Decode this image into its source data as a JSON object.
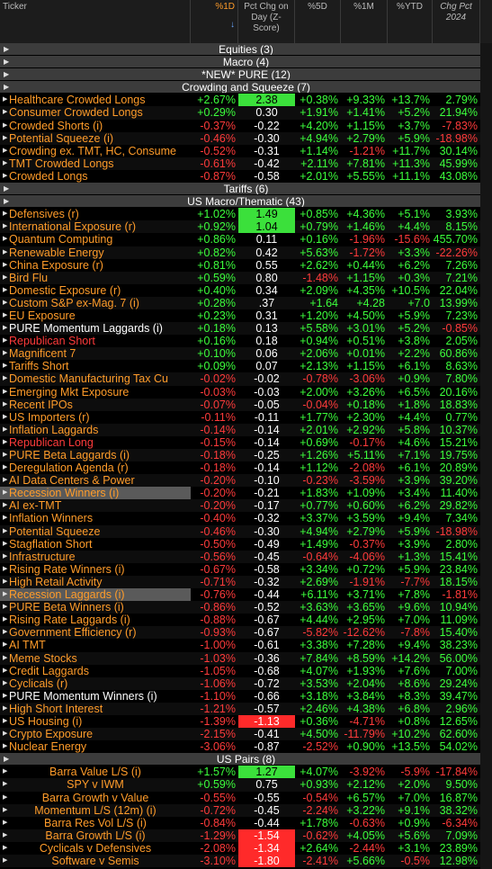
{
  "header": {
    "ticker": "Ticker",
    "pct1d": "%1D",
    "sort_arrow": "↓",
    "zscore": "Pct Chg on Day (Z-Score)",
    "pct5d": "%5D",
    "pct1m": "%1M",
    "pctytd": "%YTD",
    "chg2024": "Chg Pct 2024"
  },
  "colors": {
    "orange": "#ff9c2a",
    "green": "#3cff3c",
    "red": "#ff3b3b",
    "group_bg": "#3c3c3c"
  },
  "rows": [
    {
      "g": "Equities (3)"
    },
    {
      "g": "Macro (4)"
    },
    {
      "g": "*NEW* PURE (12)"
    },
    {
      "g": "Crowding and Squeeze (7)"
    },
    {
      "n": "Healthcare Crowded Longs",
      "d": "+2.67%",
      "z": "2.38",
      "zb": "g",
      "f": "+0.38%",
      "m": "+9.33%",
      "y": "+13.7%",
      "c": "2.79%"
    },
    {
      "n": "Consumer Crowded Longs",
      "d": "+0.29%",
      "z": "0.30",
      "f": "+1.91%",
      "m": "+1.41%",
      "y": "+5.2%",
      "c": "21.94%"
    },
    {
      "n": "Crowded Shorts (i)",
      "d": "-0.37%",
      "z": "-0.22",
      "f": "+4.20%",
      "m": "+1.15%",
      "y": "+3.7%",
      "c": "-7.83%"
    },
    {
      "n": "Potential Squeeze (i)",
      "d": "-0.46%",
      "z": "-0.30",
      "f": "+4.94%",
      "m": "+2.79%",
      "y": "+5.9%",
      "c": "-18.98%"
    },
    {
      "n": "Crowding ex. TMT, HC, Consume",
      "d": "-0.52%",
      "z": "-0.31",
      "f": "+1.14%",
      "m": "-1.21%",
      "y": "+11.7%",
      "c": "30.14%"
    },
    {
      "n": "TMT Crowded Longs",
      "d": "-0.61%",
      "z": "-0.42",
      "f": "+2.11%",
      "m": "+7.81%",
      "y": "+11.3%",
      "c": "45.99%"
    },
    {
      "n": "Crowded Longs",
      "d": "-0.87%",
      "z": "-0.58",
      "f": "+2.01%",
      "m": "+5.55%",
      "y": "+11.1%",
      "c": "43.08%"
    },
    {
      "g": "Tariffs (6)"
    },
    {
      "g": "US Macro/Thematic (43)"
    },
    {
      "n": "Defensives (r)",
      "d": "+1.02%",
      "z": "1.49",
      "zb": "g",
      "f": "+0.85%",
      "m": "+4.36%",
      "y": "+5.1%",
      "c": "3.93%"
    },
    {
      "n": "International Exposure (r)",
      "d": "+0.92%",
      "z": "1.04",
      "zb": "g",
      "f": "+0.79%",
      "m": "+1.46%",
      "y": "+4.4%",
      "c": "8.15%"
    },
    {
      "n": "Quantum Computing",
      "d": "+0.86%",
      "z": "0.11",
      "f": "+0.16%",
      "m": "-1.96%",
      "y": "-15.6%",
      "c": "455.70%"
    },
    {
      "n": "Renewable Energy",
      "d": "+0.82%",
      "z": "0.42",
      "f": "+5.63%",
      "m": "-1.72%",
      "y": "+3.3%",
      "c": "-22.26%"
    },
    {
      "n": "China Exposure (r)",
      "d": "+0.81%",
      "z": "0.55",
      "f": "+2.62%",
      "m": "+0.44%",
      "y": "+6.2%",
      "c": "7.26%"
    },
    {
      "n": "Bird Flu",
      "d": "+0.59%",
      "z": "0.80",
      "f": "-1.48%",
      "m": "+1.15%",
      "y": "+0.3%",
      "c": "7.21%"
    },
    {
      "n": "Domestic Exposure (r)",
      "d": "+0.40%",
      "z": "0.34",
      "f": "+2.09%",
      "m": "+4.35%",
      "y": "+10.5%",
      "c": "22.04%"
    },
    {
      "n": "Custom S&P ex-Mag. 7 (i)",
      "d": "+0.28%",
      "z": ".37",
      "f": "+1.64",
      "m": "+4.28",
      "y": "+7.0",
      "c": "13.99%"
    },
    {
      "n": "EU Exposure",
      "d": "+0.23%",
      "z": "0.31",
      "f": "+1.20%",
      "m": "+4.50%",
      "y": "+5.9%",
      "c": "7.23%"
    },
    {
      "n": "PURE Momentum Laggards (i)",
      "nc": "white",
      "d": "+0.18%",
      "z": "0.13",
      "f": "+5.58%",
      "m": "+3.01%",
      "y": "+5.2%",
      "c": "-0.85%"
    },
    {
      "n": "Republican Short",
      "nc": "red",
      "d": "+0.16%",
      "z": "0.18",
      "f": "+0.94%",
      "m": "+0.51%",
      "y": "+3.8%",
      "c": "2.05%"
    },
    {
      "n": "Magnificent 7",
      "d": "+0.10%",
      "z": "0.06",
      "f": "+2.06%",
      "m": "+0.01%",
      "y": "+2.2%",
      "c": "60.86%"
    },
    {
      "n": "Tariffs Short",
      "d": "+0.09%",
      "z": "0.07",
      "f": "+2.13%",
      "m": "+1.15%",
      "y": "+6.1%",
      "c": "8.63%"
    },
    {
      "n": "Domestic Manufacturing Tax Cu",
      "d": "-0.02%",
      "z": "-0.02",
      "f": "-0.78%",
      "m": "-3.06%",
      "y": "+0.9%",
      "c": "7.80%"
    },
    {
      "n": "Emerging Mkt Exposure",
      "d": "-0.03%",
      "z": "-0.03",
      "f": "+2.00%",
      "m": "+3.26%",
      "y": "+6.5%",
      "c": "20.16%"
    },
    {
      "n": "Recent IPOs",
      "d": "-0.07%",
      "z": "-0.05",
      "f": "-0.04%",
      "m": "+0.18%",
      "y": "+1.8%",
      "c": "18.83%"
    },
    {
      "n": "US Importers (r)",
      "d": "-0.11%",
      "z": "-0.11",
      "f": "+1.77%",
      "m": "+2.30%",
      "y": "+4.4%",
      "c": "0.77%"
    },
    {
      "n": "Inflation Laggards",
      "d": "-0.14%",
      "z": "-0.14",
      "f": "+2.01%",
      "m": "+2.92%",
      "y": "+5.8%",
      "c": "10.37%"
    },
    {
      "n": "Republican Long",
      "nc": "red",
      "d": "-0.15%",
      "z": "-0.14",
      "f": "+0.69%",
      "m": "-0.17%",
      "y": "+4.6%",
      "c": "15.21%"
    },
    {
      "n": "PURE Beta Laggards (i)",
      "d": "-0.18%",
      "z": "-0.25",
      "f": "+1.26%",
      "m": "+5.11%",
      "y": "+7.1%",
      "c": "19.75%"
    },
    {
      "n": "Deregulation Agenda (r)",
      "d": "-0.18%",
      "z": "-0.14",
      "f": "+1.12%",
      "m": "-2.08%",
      "y": "+6.1%",
      "c": "20.89%"
    },
    {
      "n": "AI Data Centers & Power",
      "d": "-0.20%",
      "z": "-0.10",
      "f": "-0.23%",
      "m": "-3.59%",
      "y": "+3.9%",
      "c": "39.20%"
    },
    {
      "n": "Recession Winners (i)",
      "hl": true,
      "d": "-0.20%",
      "z": "-0.21",
      "f": "+1.83%",
      "m": "+1.09%",
      "y": "+3.4%",
      "c": "11.40%"
    },
    {
      "n": "AI ex-TMT",
      "d": "-0.20%",
      "z": "-0.17",
      "f": "+0.77%",
      "m": "+0.60%",
      "y": "+6.2%",
      "c": "29.82%"
    },
    {
      "n": "Inflation Winners",
      "d": "-0.40%",
      "z": "-0.32",
      "f": "+3.37%",
      "m": "+3.59%",
      "y": "+9.4%",
      "c": "7.34%"
    },
    {
      "n": "Potential Squeeze",
      "d": "-0.46%",
      "z": "-0.30",
      "f": "+4.94%",
      "m": "+2.79%",
      "y": "+5.9%",
      "c": "-18.98%"
    },
    {
      "n": "Stagflation Short",
      "d": "-0.50%",
      "z": "-0.49",
      "f": "+1.49%",
      "m": "-0.37%",
      "y": "+3.9%",
      "c": "2.80%"
    },
    {
      "n": "Infrastructure",
      "d": "-0.56%",
      "z": "-0.45",
      "f": "-0.64%",
      "m": "-4.06%",
      "y": "+1.3%",
      "c": "15.41%"
    },
    {
      "n": "Rising Rate Winners (i)",
      "d": "-0.67%",
      "z": "-0.58",
      "f": "+3.34%",
      "m": "+0.72%",
      "y": "+5.9%",
      "c": "23.84%"
    },
    {
      "n": "High Retail Activity",
      "d": "-0.71%",
      "z": "-0.32",
      "f": "+2.69%",
      "m": "-1.91%",
      "y": "-7.7%",
      "c": "18.15%"
    },
    {
      "n": "Recession Laggards (i)",
      "hl": true,
      "d": "-0.76%",
      "z": "-0.44",
      "f": "+6.11%",
      "m": "+3.71%",
      "y": "+7.8%",
      "c": "-1.81%"
    },
    {
      "n": "PURE Beta Winners (i)",
      "d": "-0.86%",
      "z": "-0.52",
      "f": "+3.63%",
      "m": "+3.65%",
      "y": "+9.6%",
      "c": "10.94%"
    },
    {
      "n": "Rising Rate Laggards (i)",
      "d": "-0.88%",
      "z": "-0.67",
      "f": "+4.44%",
      "m": "+2.95%",
      "y": "+7.0%",
      "c": "11.09%"
    },
    {
      "n": "Government Efficiency (r)",
      "d": "-0.93%",
      "z": "-0.67",
      "f": "-5.82%",
      "m": "-12.62%",
      "y": "-7.8%",
      "c": "15.40%"
    },
    {
      "n": "AI TMT",
      "d": "-1.00%",
      "z": "-0.61",
      "f": "+3.38%",
      "m": "+7.28%",
      "y": "+9.4%",
      "c": "38.23%"
    },
    {
      "n": "Meme Stocks",
      "d": "-1.03%",
      "z": "-0.36",
      "f": "+7.84%",
      "m": "+8.59%",
      "y": "+14.2%",
      "c": "56.00%"
    },
    {
      "n": "Credit Laggards",
      "d": "-1.05%",
      "z": "-0.68",
      "f": "+4.07%",
      "m": "+1.93%",
      "y": "+7.6%",
      "c": "7.00%"
    },
    {
      "n": "Cyclicals (r)",
      "d": "-1.06%",
      "z": "-0.72",
      "f": "+3.53%",
      "m": "+2.04%",
      "y": "+8.6%",
      "c": "29.24%"
    },
    {
      "n": "PURE Momentum Winners (i)",
      "nc": "white",
      "d": "-1.10%",
      "z": "-0.66",
      "f": "+3.18%",
      "m": "+3.84%",
      "y": "+8.3%",
      "c": "39.47%"
    },
    {
      "n": "High Short Interest",
      "d": "-1.21%",
      "z": "-0.57",
      "f": "+2.46%",
      "m": "+4.38%",
      "y": "+6.8%",
      "c": "2.96%"
    },
    {
      "n": "US Housing (i)",
      "d": "-1.39%",
      "z": "-1.13",
      "zb": "r",
      "f": "+0.36%",
      "m": "-4.71%",
      "y": "+0.8%",
      "c": "12.65%"
    },
    {
      "n": "Crypto Exposure",
      "d": "-2.15%",
      "z": "-0.41",
      "f": "+4.50%",
      "m": "-11.79%",
      "y": "+10.2%",
      "c": "62.60%"
    },
    {
      "n": "Nuclear Energy",
      "d": "-3.06%",
      "z": "-0.87",
      "f": "-2.52%",
      "m": "+0.90%",
      "y": "+13.5%",
      "c": "54.02%"
    },
    {
      "g": "US Pairs (8)"
    },
    {
      "n": "Barra Value L/S (i)",
      "ctr": true,
      "d": "+1.57%",
      "z": "1.27",
      "zb": "g",
      "f": "+4.07%",
      "m": "-3.92%",
      "y": "-5.9%",
      "c": "-17.84%"
    },
    {
      "n": "SPY v IWM",
      "ctr": true,
      "d": "+0.59%",
      "z": "0.75",
      "f": "+0.93%",
      "m": "+2.12%",
      "y": "+2.0%",
      "c": "9.50%"
    },
    {
      "n": "Barra Growth v Value",
      "ctr": true,
      "d": "-0.55%",
      "z": "-0.55",
      "f": "-0.54%",
      "m": "+6.57%",
      "y": "+7.0%",
      "c": "16.87%"
    },
    {
      "n": "Momentum L/S (12m) (i)",
      "ctr": true,
      "d": "-0.72%",
      "z": "-0.45",
      "f": "-2.24%",
      "m": "+3.22%",
      "y": "+9.1%",
      "c": "38.32%"
    },
    {
      "n": "Barra Res Vol L/S (i)",
      "ctr": true,
      "d": "-0.84%",
      "z": "-0.44",
      "f": "+1.78%",
      "m": "-0.63%",
      "y": "+0.9%",
      "c": "-6.34%"
    },
    {
      "n": "Barra Growth L/S (i)",
      "ctr": true,
      "d": "-1.29%",
      "z": "-1.54",
      "zb": "r",
      "f": "-0.62%",
      "m": "+4.05%",
      "y": "+5.6%",
      "c": "7.09%"
    },
    {
      "n": "Cyclicals v Defensives",
      "ctr": true,
      "d": "-2.08%",
      "z": "-1.34",
      "zb": "r",
      "f": "+2.64%",
      "m": "-2.44%",
      "y": "+3.1%",
      "c": "23.89%"
    },
    {
      "n": "Software v Semis",
      "ctr": true,
      "d": "-3.10%",
      "z": "-1.80",
      "zb": "r",
      "f": "-2.41%",
      "m": "+5.66%",
      "y": "-0.5%",
      "c": "12.98%"
    }
  ]
}
